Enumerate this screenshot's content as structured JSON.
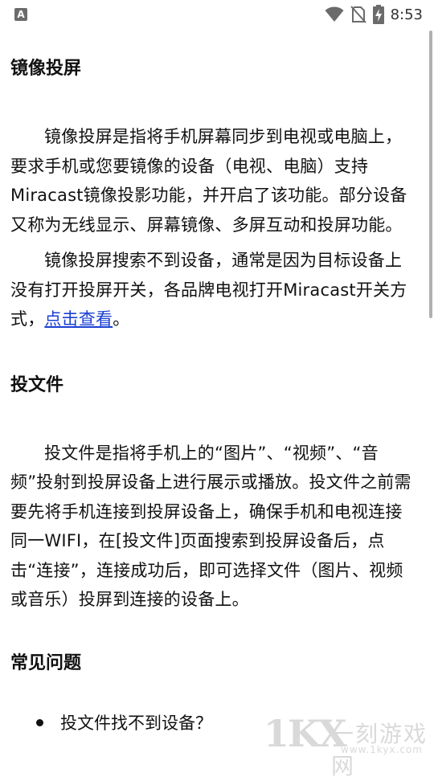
{
  "status_bar": {
    "notification_icon": "A",
    "time": "8:53",
    "icons": [
      "wifi-icon",
      "no-sim-icon",
      "battery-charging-icon"
    ]
  },
  "sections": [
    {
      "title": "镜像投屏",
      "paragraphs": [
        "镜像投屏是指将手机屏幕同步到电视或电脑上，要求手机或您要镜像的设备（电视、电脑）支持Miracast镜像投影功能，并开启了该功能。部分设备又称为无线显示、屏幕镜像、多屏互动和投屏功能。",
        {
          "before_link": "镜像投屏搜索不到设备，通常是因为目标设备上没有打开投屏开关，各品牌电视打开Miracast开关方式，",
          "link_text": "点击查看",
          "after_link": "。"
        }
      ]
    },
    {
      "title": "投文件",
      "paragraphs": [
        "投文件是指将手机上的“图片”、“视频”、“音频”投射到投屏设备上进行展示或播放。投文件之前需要先将手机连接到投屏设备上，确保手机和电视连接同一WIFI，在[投文件]页面搜索到投屏设备后，点击“连接”，连接成功后，即可选择文件（图片、视频或音乐）投屏到连接的设备上。"
      ]
    },
    {
      "title": "常见问题",
      "items": [
        "投文件找不到设备？"
      ]
    }
  ],
  "watermark": {
    "logo": "1KX",
    "name": "一刻游戏网",
    "url": "www.1kyx.com"
  },
  "colors": {
    "link": "#1a3fd1",
    "text": "#111111",
    "background": "#ffffff"
  }
}
